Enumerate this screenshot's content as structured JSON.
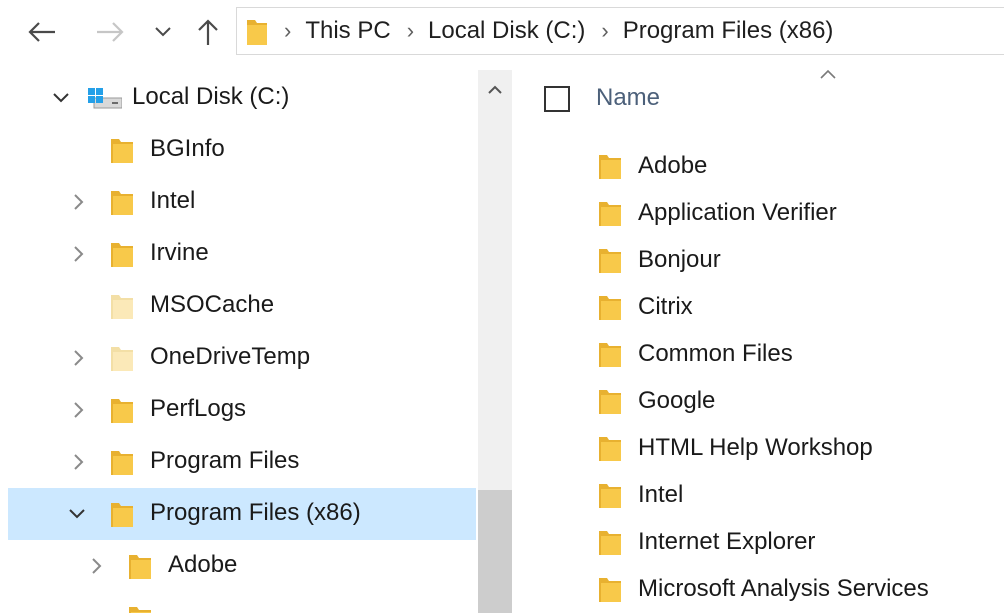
{
  "address_bar": {
    "crumbs": [
      "This PC",
      "Local Disk (C:)",
      "Program Files (x86)"
    ]
  },
  "nav_pane": {
    "items": [
      {
        "label": "Local Disk (C:)",
        "expanded": true,
        "icon": "drive-icon"
      },
      {
        "label": "BGInfo",
        "has_children": false
      },
      {
        "label": "Intel",
        "has_children": true
      },
      {
        "label": "Irvine",
        "has_children": true
      },
      {
        "label": "MSOCache",
        "has_children": false,
        "faded": true
      },
      {
        "label": "OneDriveTemp",
        "has_children": true,
        "faded": true
      },
      {
        "label": "PerfLogs",
        "has_children": true
      },
      {
        "label": "Program Files",
        "has_children": true
      },
      {
        "label": "Program Files (x86)",
        "expanded": true,
        "selected": true
      },
      {
        "label": "Adobe",
        "has_children": true,
        "indent": 2
      }
    ]
  },
  "content": {
    "column_header": "Name",
    "files": [
      "Adobe",
      "Application Verifier",
      "Bonjour",
      "Citrix",
      "Common Files",
      "Google",
      "HTML Help Workshop",
      "Intel",
      "Internet Explorer",
      "Microsoft Analysis Services"
    ]
  },
  "colors": {
    "selection": "#cce8ff",
    "folder_yellow": "#f8c94a",
    "header_text": "#4c607a"
  }
}
